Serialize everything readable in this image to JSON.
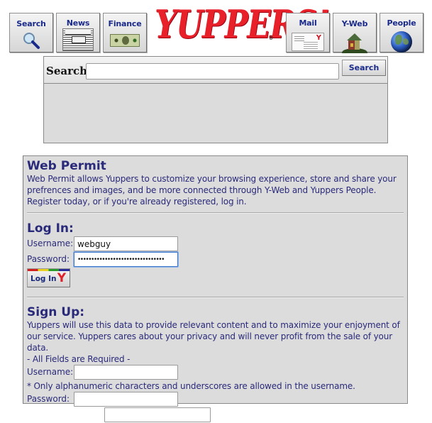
{
  "nav": {
    "buttons": [
      {
        "label": "Search",
        "icon": "magnifier-icon"
      },
      {
        "label": "News",
        "icon": "newspaper-icon"
      },
      {
        "label": "Finance",
        "icon": "dollar-bill-icon"
      },
      {
        "label": "Mail",
        "icon": "envelope-icon"
      },
      {
        "label": "Y-Web",
        "icon": "house-icon"
      },
      {
        "label": "People",
        "icon": "globe-icon"
      }
    ],
    "logo_text": "YUPPERS!",
    "logo_mark": "®"
  },
  "search": {
    "label": "Search:",
    "value": "",
    "placeholder": "",
    "button_label": "Search"
  },
  "permit": {
    "title": "Web Permit",
    "intro": "Web Permit allows Yuppers to customize your browsing experience, store and share your prefrences and images, and be more connected through Y-Web and Yuppers People. Register today, or if you're already registered, log in.",
    "login": {
      "title": "Log In:",
      "username_label": "Username:",
      "username_value": "webguy",
      "password_label": "Password:",
      "password_value": "••••••••••••••••••••••••••••••••",
      "button_label": "Log In",
      "button_mark": "Y"
    },
    "signup": {
      "title": "Sign Up:",
      "intro": "Yuppers will use this data to provide relevant content and to maximize your enjoyment of our service. Yuppers cares about your privacy and will never profit from the sale of your data.",
      "required_note": "- All Fields are Required -",
      "username_label": "Username:",
      "username_value": "",
      "username_hint": "* Only alphanumeric characters and underscores are allowed in the username.",
      "password_label": "Password:",
      "password_value": ""
    }
  },
  "colors": {
    "accent_text": "#2a2a7a",
    "button_text": "#1a2a8a",
    "logo_red": "#e8202a",
    "panel_bg": "#dcdcdc"
  }
}
